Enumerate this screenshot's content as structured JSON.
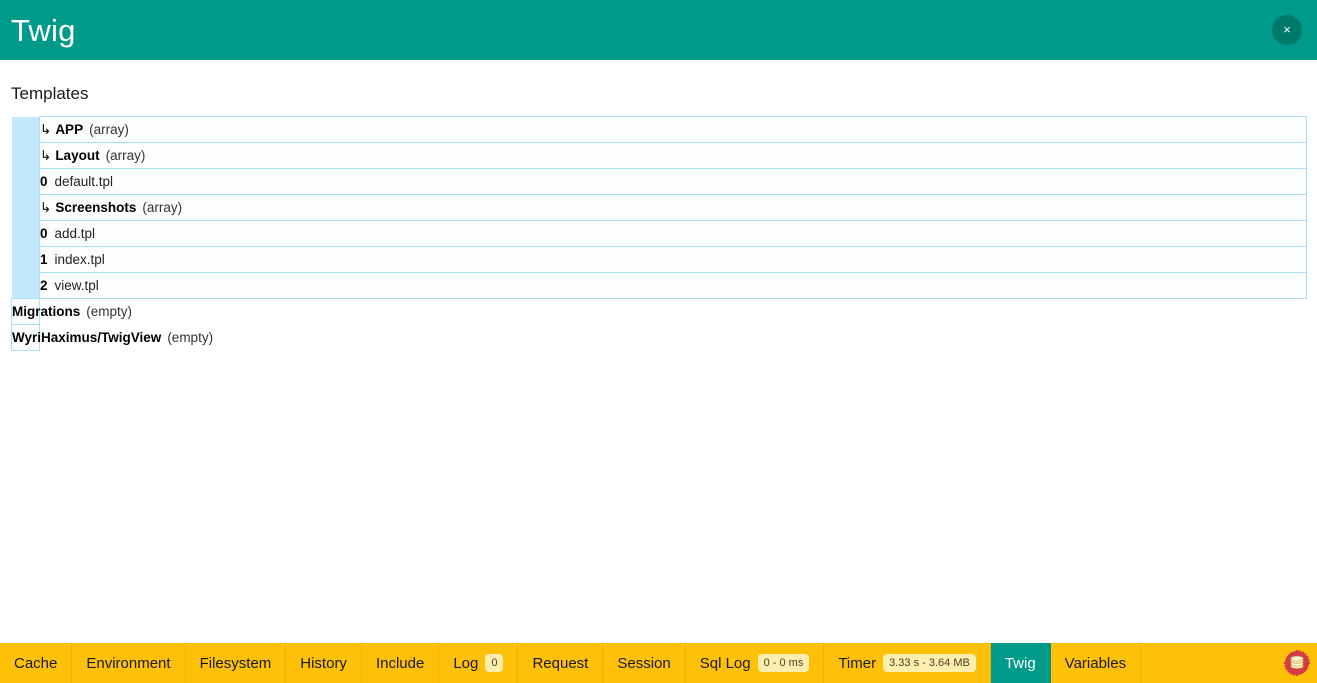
{
  "header": {
    "title": "Twig",
    "close_label": "×",
    "teal": "#009a8a"
  },
  "main": {
    "section_title": "Templates",
    "tree_rows": [
      {
        "indent": 1,
        "arrow": "↳",
        "key": "APP",
        "type": "(array)",
        "value": ""
      },
      {
        "indent": 2,
        "arrow": "↳",
        "key": "Layout",
        "type": "(array)",
        "value": ""
      },
      {
        "indent": 3,
        "arrow": "",
        "key": "0",
        "type": "",
        "value": "default.tpl"
      },
      {
        "indent": 2,
        "arrow": "↳",
        "key": "Screenshots",
        "type": "(array)",
        "value": ""
      },
      {
        "indent": 3,
        "arrow": "",
        "key": "0",
        "type": "",
        "value": "add.tpl"
      },
      {
        "indent": 3,
        "arrow": "",
        "key": "1",
        "type": "",
        "value": "index.tpl"
      },
      {
        "indent": 3,
        "arrow": "",
        "key": "2",
        "type": "",
        "value": "view.tpl"
      },
      {
        "indent": 0,
        "arrow": "",
        "key": "Migrations",
        "type": "(empty)",
        "value": ""
      },
      {
        "indent": 0,
        "arrow": "",
        "key": "WyriHaximus/TwigView",
        "type": "(empty)",
        "value": ""
      }
    ]
  },
  "toolbar": {
    "accent": "#ffc107",
    "items": [
      {
        "label": "Cache",
        "badge": "",
        "active": false
      },
      {
        "label": "Environment",
        "badge": "",
        "active": false
      },
      {
        "label": "Filesystem",
        "badge": "",
        "active": false
      },
      {
        "label": "History",
        "badge": "",
        "active": false
      },
      {
        "label": "Include",
        "badge": "",
        "active": false
      },
      {
        "label": "Log",
        "badge": "0",
        "active": false
      },
      {
        "label": "Request",
        "badge": "",
        "active": false
      },
      {
        "label": "Session",
        "badge": "",
        "active": false
      },
      {
        "label": "Sql Log",
        "badge": "0 - 0 ms",
        "active": false
      },
      {
        "label": "Timer",
        "badge": "3.33 s - 3.64 MB",
        "active": false
      },
      {
        "label": "Twig",
        "badge": "",
        "active": true
      },
      {
        "label": "Variables",
        "badge": "",
        "active": false
      }
    ],
    "logo": "cakephp-logo"
  }
}
